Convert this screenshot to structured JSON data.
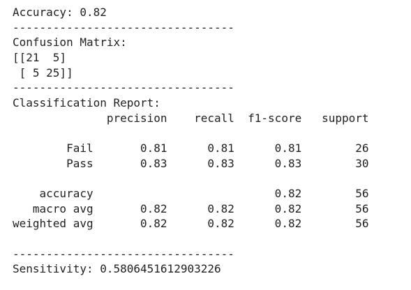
{
  "output": {
    "accuracy_line": "Accuracy: 0.82",
    "separator": "---------------------------------",
    "confusion_title": "Confusion Matrix:",
    "confusion_rows": [
      "[[21  5]",
      " [ 5 25]]"
    ],
    "report_title": "Classification Report:",
    "report_lines": [
      "              precision    recall  f1-score   support",
      "",
      "        Fail       0.81      0.81      0.81        26",
      "        Pass       0.83      0.83      0.83        30",
      "",
      "    accuracy                           0.82        56",
      "   macro avg       0.82      0.82      0.82        56",
      "weighted avg       0.82      0.82      0.82        56"
    ],
    "sensitivity_line": "Sensitivity: 0.5806451612903226"
  }
}
